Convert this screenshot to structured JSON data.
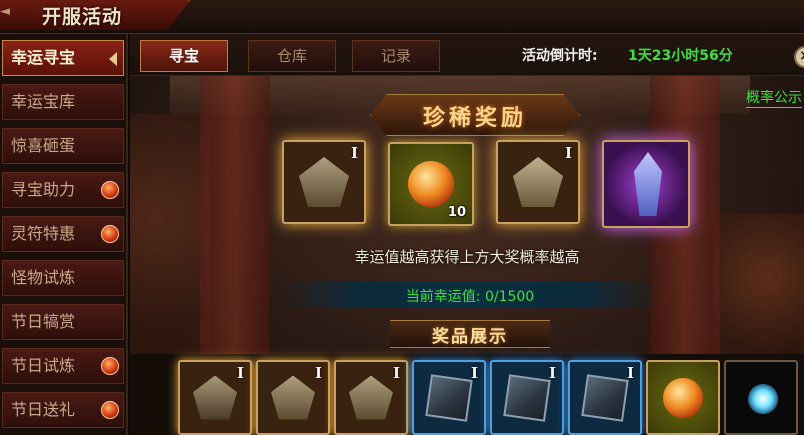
{
  "header": {
    "title": "开服活动"
  },
  "sidebar": {
    "items": [
      {
        "label": "幸运寻宝",
        "active": true,
        "badge": false
      },
      {
        "label": "幸运宝库",
        "active": false,
        "badge": false
      },
      {
        "label": "惊喜砸蛋",
        "active": false,
        "badge": false
      },
      {
        "label": "寻宝助力",
        "active": false,
        "badge": true
      },
      {
        "label": "灵符特惠",
        "active": false,
        "badge": true
      },
      {
        "label": "怪物试炼",
        "active": false,
        "badge": false
      },
      {
        "label": "节日犒赏",
        "active": false,
        "badge": false
      },
      {
        "label": "节日试炼",
        "active": false,
        "badge": true
      },
      {
        "label": "节日送礼",
        "active": false,
        "badge": true
      }
    ]
  },
  "tabs": [
    {
      "label": "寻宝",
      "active": true
    },
    {
      "label": "仓库",
      "active": false
    },
    {
      "label": "记录",
      "active": false
    }
  ],
  "countdown": {
    "label": "活动倒计时:",
    "value": "1天23小时56分"
  },
  "odds_link": "概率公示",
  "rare_rewards": {
    "title": "珍稀奖励",
    "items": [
      {
        "icon": "fist-rune-icon",
        "tier": "I",
        "qty": ""
      },
      {
        "icon": "fire-orb-icon",
        "tier": "",
        "qty": "10"
      },
      {
        "icon": "warrior-rune-icon",
        "tier": "I",
        "qty": ""
      },
      {
        "icon": "armor-set-icon",
        "tier": "",
        "qty": ""
      }
    ]
  },
  "hint": "幸运值越高获得上方大奖概率越高",
  "luck": {
    "label": "当前幸运值: 0/1500",
    "current": 0,
    "max": 1500
  },
  "prizes": {
    "title": "奖品展示",
    "items": [
      {
        "icon": "sword-rune-icon",
        "tier": "I"
      },
      {
        "icon": "fist-rune-icon",
        "tier": "I"
      },
      {
        "icon": "fist-rune-icon",
        "tier": "I"
      },
      {
        "icon": "crossed-swords-gem-icon",
        "tier": "I"
      },
      {
        "icon": "broken-gem-icon",
        "tier": "I"
      },
      {
        "icon": "shield-gem-icon",
        "tier": "I"
      },
      {
        "icon": "fire-orb-icon",
        "tier": ""
      },
      {
        "icon": "sparkle-crystal-icon",
        "tier": ""
      }
    ]
  }
}
